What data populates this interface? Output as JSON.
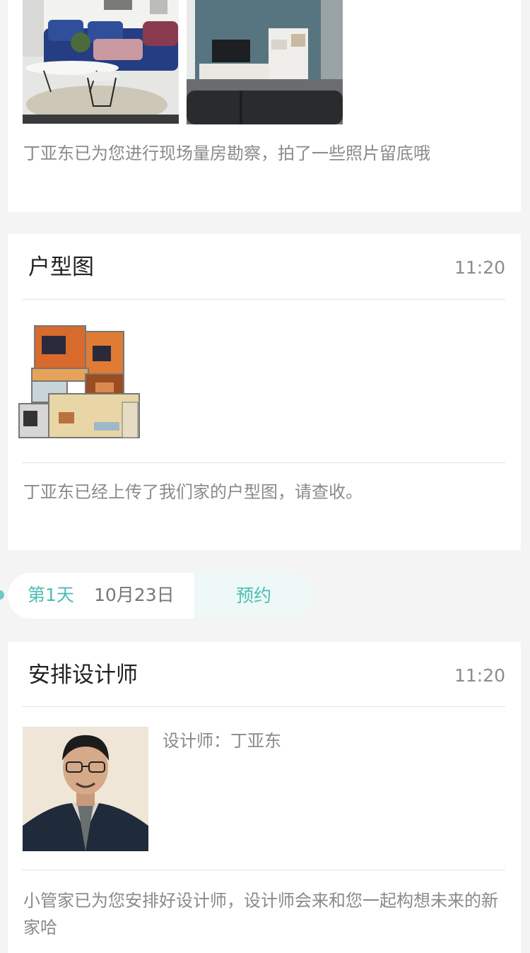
{
  "survey_card": {
    "description": "丁亚东已为您进行现场量房勘察，拍了一些照片留底哦"
  },
  "floorplan_card": {
    "title": "户型图",
    "time": "11:20",
    "description": "丁亚东已经上传了我们家的户型图，请查收。"
  },
  "day_marker": {
    "day": "第1天",
    "date": "10月23日",
    "appointment": "预约"
  },
  "designer_card": {
    "title": "安排设计师",
    "time": "11:20",
    "designer_label": "设计师：丁亚东",
    "description": "小管家已为您安排好设计师，设计师会来和您一起构想未来的新家哈"
  },
  "colors": {
    "accent": "#4fbcb4",
    "accent_light": "#edf8f7",
    "background": "#f4f4f4"
  }
}
